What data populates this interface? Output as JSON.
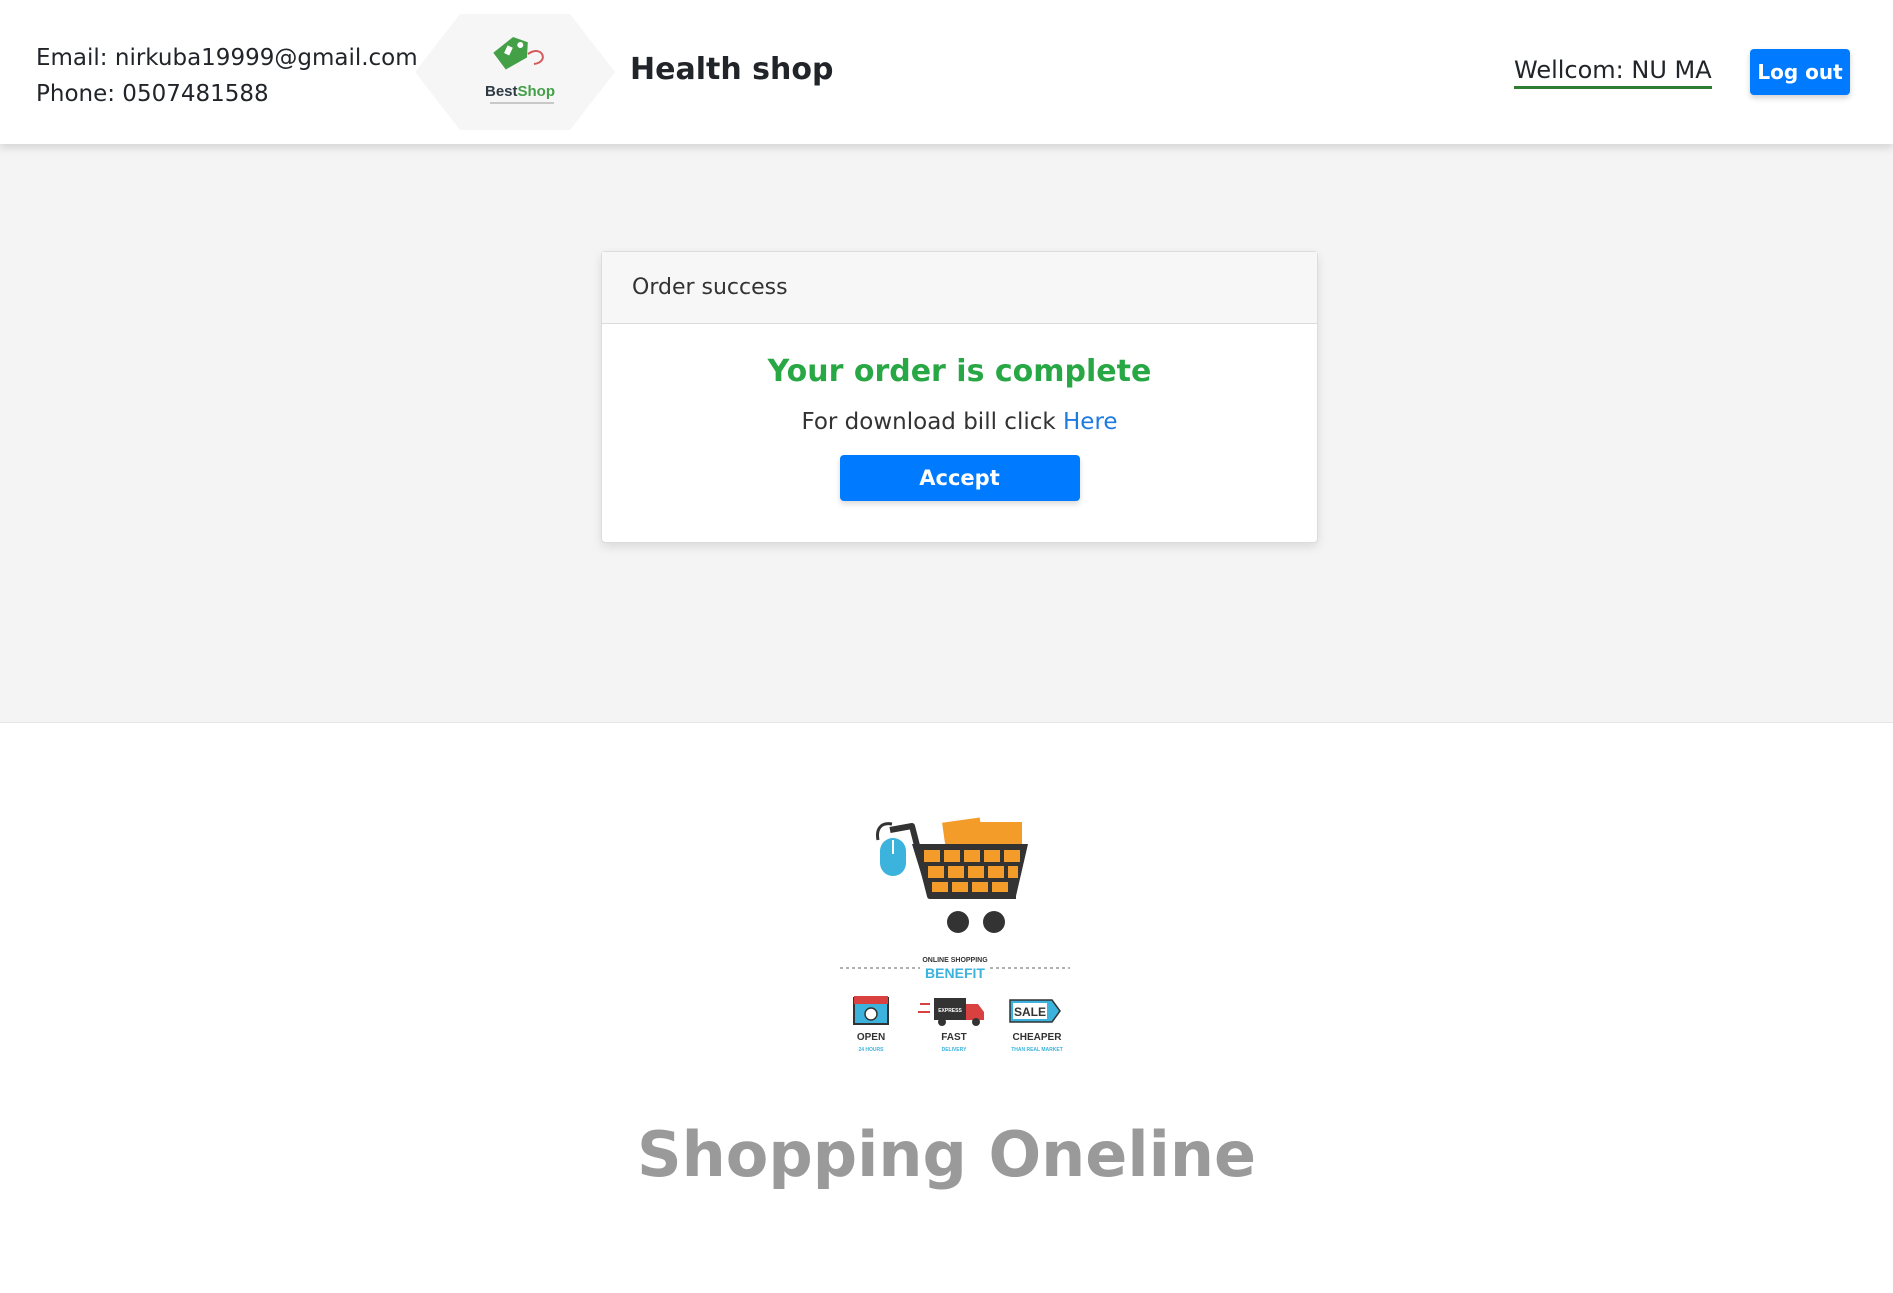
{
  "header": {
    "email_label": "Email: nirkuba19999@gmail.com",
    "phone_label": "Phone: 0507481588",
    "logo_text": "BestShop",
    "shop_name": "Health shop",
    "welcome_text": "Wellcom: NU MA",
    "logout_label": "Log out"
  },
  "order_card": {
    "header_title": "Order success",
    "success_message": "Your order is complete",
    "download_prefix": "For download bill click",
    "download_link": "Here",
    "accept_label": "Accept"
  },
  "footer": {
    "banner": {
      "subtitle": "ONLINE SHOPPING",
      "title": "BENEFIT",
      "features": [
        {
          "title": "OPEN",
          "caption": "24 HOURS",
          "icon": "shop-icon"
        },
        {
          "title": "FAST",
          "caption": "DELIVERY",
          "icon": "truck-icon"
        },
        {
          "title": "CHEAPER",
          "caption": "THAN REAL MARKET",
          "icon": "sale-tag-icon"
        }
      ],
      "sale_tag_text": "SALE",
      "truck_text": "EXPRESS"
    },
    "title": "Shopping Oneline"
  },
  "colors": {
    "primary_button": "#007bff",
    "success_text": "#28a745",
    "welcome_underline": "#2e7d32",
    "logo_green": "#43a047",
    "cart_orange": "#f39c2a",
    "banner_blue": "#3bb3dd"
  }
}
